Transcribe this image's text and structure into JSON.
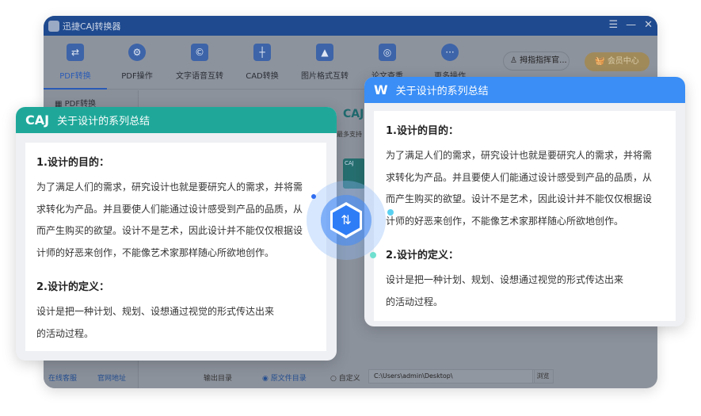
{
  "app": {
    "title": "迅捷CAJ转换器",
    "window_controls": [
      "☰",
      "—",
      "✕"
    ]
  },
  "toolbar": {
    "tabs": [
      {
        "label": "PDF转换",
        "icon": "swap-icon"
      },
      {
        "label": "PDF操作",
        "icon": "gear-icon"
      },
      {
        "label": "文字语音互转",
        "icon": "audio-icon"
      },
      {
        "label": "CAD转换",
        "icon": "cad-icon"
      },
      {
        "label": "图片格式互转",
        "icon": "image-icon"
      },
      {
        "label": "论文查重",
        "icon": "search-doc-icon"
      },
      {
        "label": "更多操作",
        "icon": "more-icon"
      }
    ],
    "active": "PDF转换",
    "user": "拇指指挥官...",
    "vip": "会员中心"
  },
  "sidebar": {
    "items": [
      "PDF转换"
    ],
    "support": "在线客服",
    "website": "官网地址"
  },
  "main": {
    "caj_label": "CAJ",
    "subtitle": "最多支持",
    "file_label": "CAJ"
  },
  "bottom": {
    "output_label": "输出目录",
    "option_original": "原文件目录",
    "option_custom": "自定义",
    "path": "C:\\Users\\admin\\Desktop\\",
    "browse": "浏览"
  },
  "colors": {
    "caj_header": "#1fa89a",
    "word_header": "#3a8ef6",
    "titlebar": "#1f4a8f",
    "accent": "#2f7df6"
  },
  "caj_card": {
    "mark": "CAJ",
    "title": "关于设计的系列总结",
    "h1": "1.设计的目的：",
    "p1": [
      "为了满足人们的需求，研究设计也就是要研究人的需求，并将需",
      "求转化为产品。并且要使人们能通过设计感受到产品的品质，从",
      "而产生购买的欲望。设计不是艺术，因此设计并不能仅仅根据设",
      "计师的好恶来创作，不能像艺术家那样随心所欲地创作。"
    ],
    "h2": "2.设计的定义：",
    "p2": [
      "设计是把一种计划、规划、设想通过视觉的形式传达出来",
      "的活动过程。"
    ]
  },
  "word_card": {
    "mark": "W",
    "title": "关于设计的系列总结",
    "h1": "1.设计的目的：",
    "p1": [
      "为了满足人们的需求，研究设计也就是要研究人的需求，并将需",
      "求转化为产品。并且要使人们能通过设计感受到产品的品质，从",
      "而产生购买的欲望。设计不是艺术，因此设计并不能仅仅根据设",
      "计师的好恶来创作，不能像艺术家那样随心所欲地创作。"
    ],
    "h2": "2.设计的定义：",
    "p2": [
      "设计是把一种计划、规划、设想通过视觉的形式传达出来",
      "的活动过程。"
    ]
  },
  "convert_icon": "convert-arrows-icon"
}
